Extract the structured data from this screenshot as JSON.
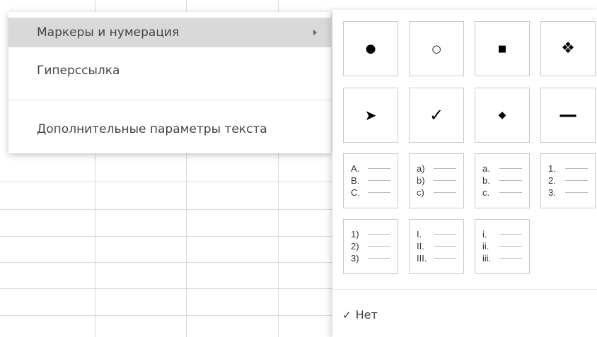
{
  "context_menu": {
    "items": [
      {
        "label": "Маркеры и нумерация",
        "has_submenu": true,
        "active": true
      },
      {
        "label": "Гиперссылка",
        "has_submenu": false,
        "active": false
      },
      {
        "label": "Дополнительные параметры текста",
        "has_submenu": false,
        "active": false
      }
    ]
  },
  "bullets": {
    "symbols": [
      {
        "glyph": "●",
        "icon": "filled-circle-bullet-icon"
      },
      {
        "glyph": "○",
        "icon": "hollow-circle-bullet-icon"
      },
      {
        "glyph": "■",
        "icon": "filled-square-bullet-icon"
      },
      {
        "glyph": "❖",
        "icon": "four-diamond-bullet-icon"
      },
      {
        "glyph": "➤",
        "icon": "arrow-bullet-icon"
      },
      {
        "glyph": "✓",
        "icon": "checkmark-bullet-icon"
      },
      {
        "glyph": "◆",
        "icon": "diamond-bullet-icon"
      },
      {
        "glyph": "—",
        "icon": "dash-bullet-icon"
      }
    ],
    "numbering": [
      {
        "lines": [
          "A.",
          "B.",
          "C."
        ]
      },
      {
        "lines": [
          "a)",
          "b)",
          "c)"
        ]
      },
      {
        "lines": [
          "a.",
          "b.",
          "c."
        ]
      },
      {
        "lines": [
          "1.",
          "2.",
          "3."
        ]
      },
      {
        "lines": [
          "1)",
          "2)",
          "3)"
        ]
      },
      {
        "lines": [
          "I.",
          "II.",
          "III."
        ]
      },
      {
        "lines": [
          "i.",
          "ii.",
          "iii."
        ]
      }
    ],
    "none_check": "✓",
    "none_label": "Нет"
  }
}
